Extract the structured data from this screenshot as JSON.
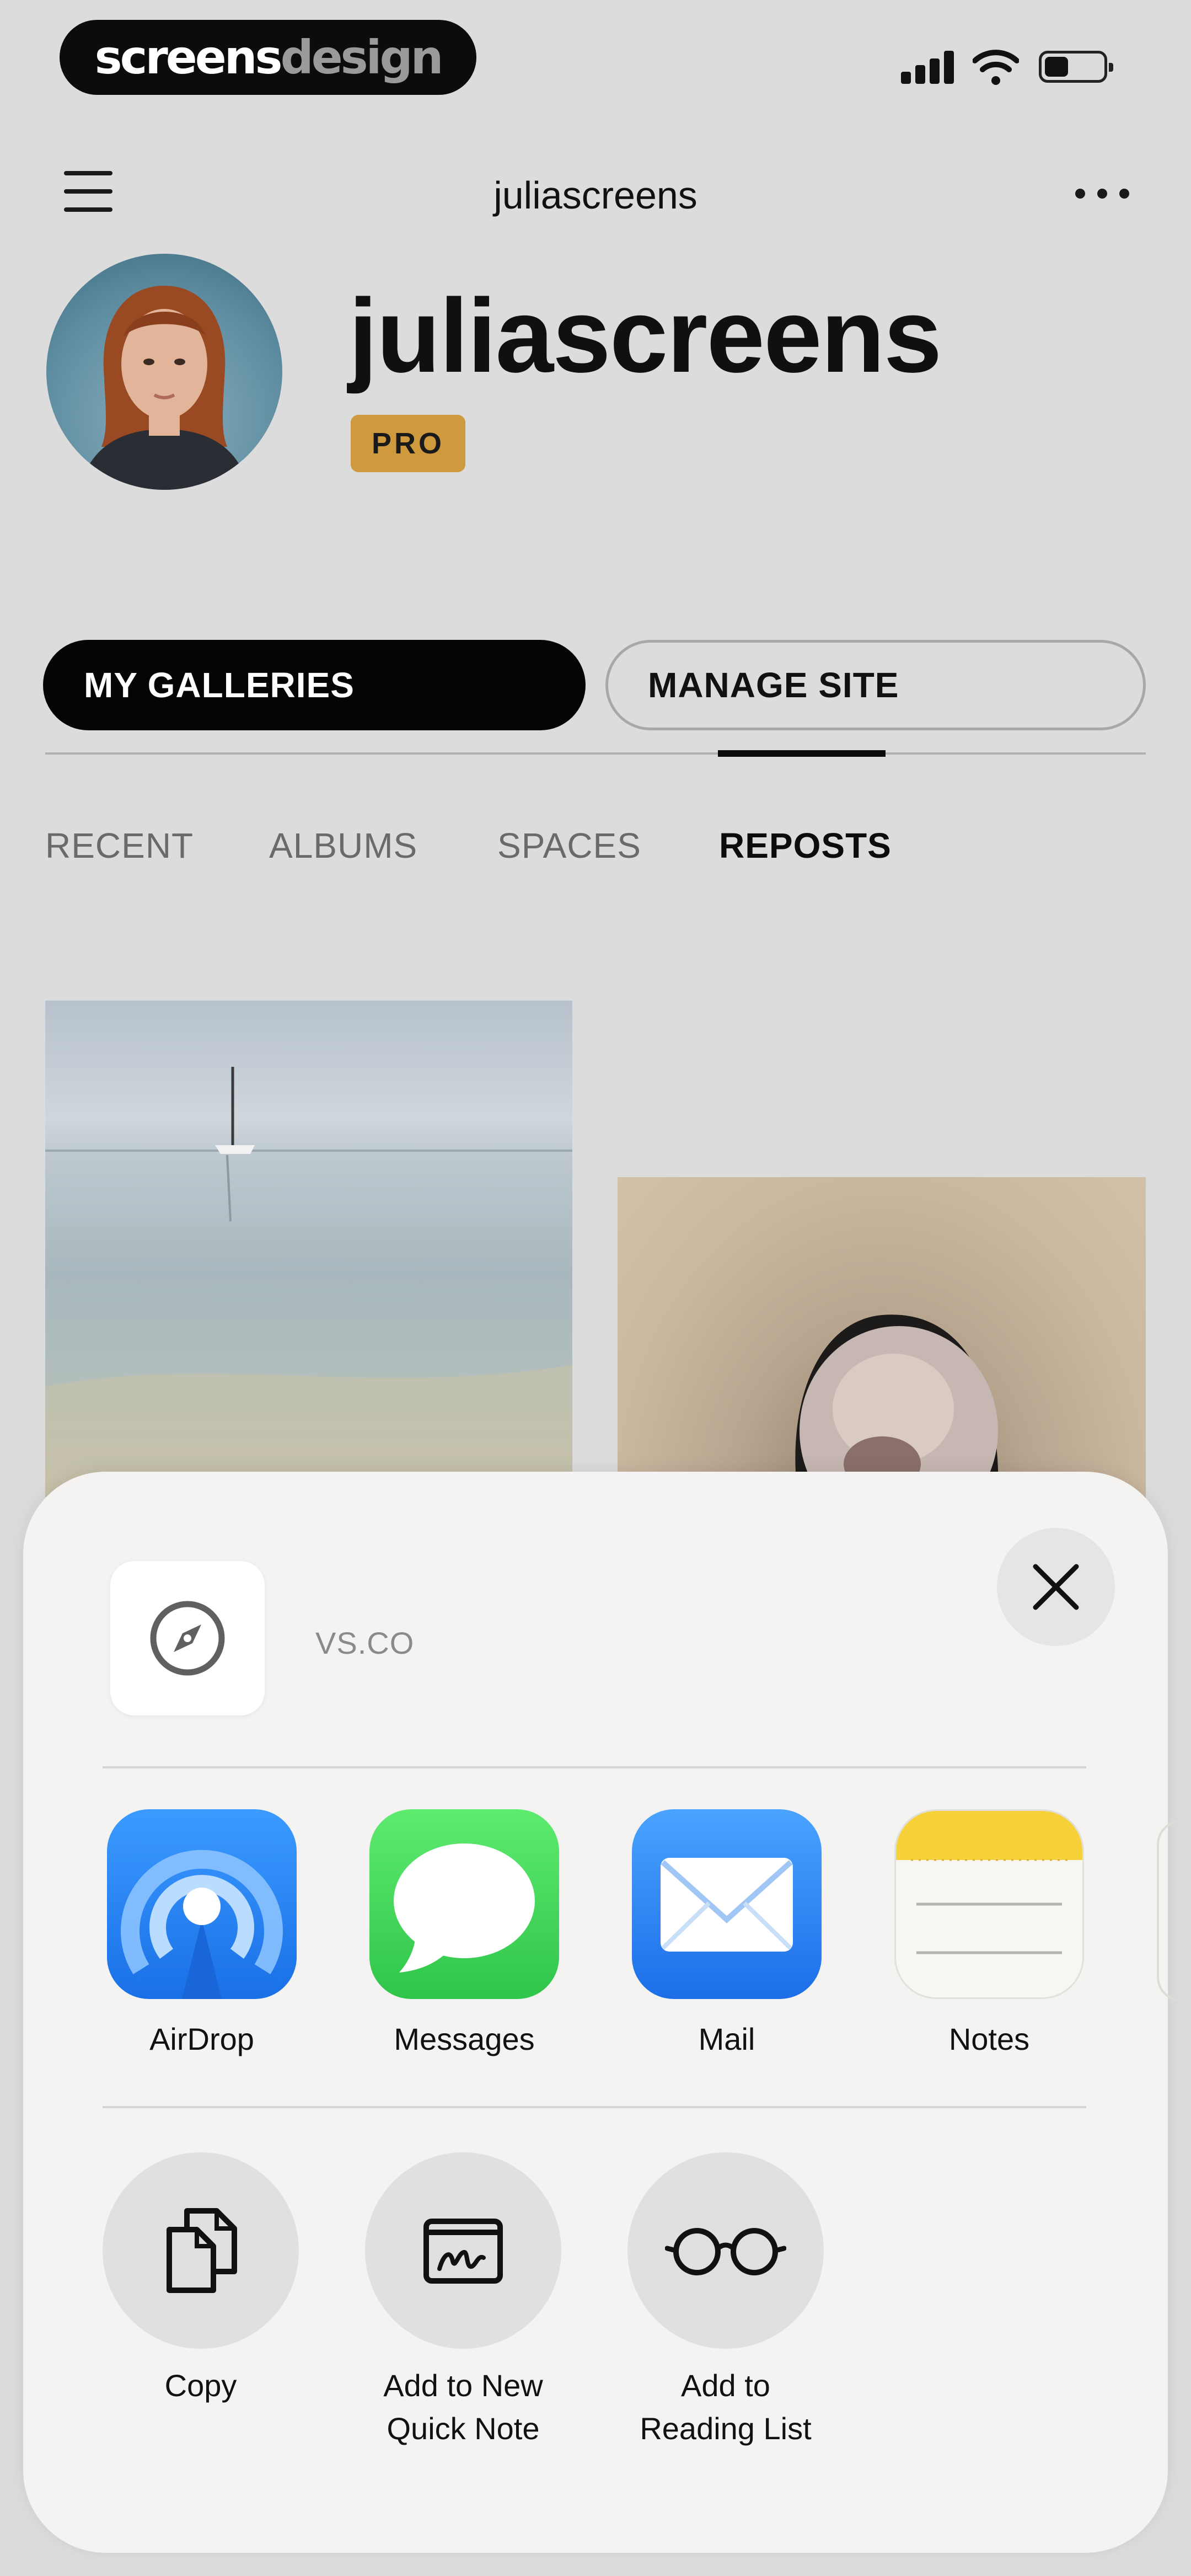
{
  "status_bar": {
    "brand_part1": "screens",
    "brand_part2": "design"
  },
  "header": {
    "title": "juliascreens",
    "menu_icon": "hamburger-icon",
    "more_icon": "ellipsis-icon"
  },
  "profile": {
    "name": "juliascreens",
    "badge": "PRO"
  },
  "buttons": {
    "my_galleries": "MY GALLERIES",
    "manage_site": "MANAGE SITE"
  },
  "tabs": [
    {
      "label": "RECENT",
      "active": false
    },
    {
      "label": "ALBUMS",
      "active": false
    },
    {
      "label": "SPACES",
      "active": false
    },
    {
      "label": "REPOSTS",
      "active": true
    }
  ],
  "share_sheet": {
    "site": "VS.CO",
    "site_icon": "compass-icon",
    "close_icon": "close-icon",
    "apps": [
      {
        "label": "AirDrop",
        "icon": "airdrop-icon"
      },
      {
        "label": "Messages",
        "icon": "messages-icon"
      },
      {
        "label": "Mail",
        "icon": "mail-icon"
      },
      {
        "label": "Notes",
        "icon": "notes-icon"
      }
    ],
    "actions": [
      {
        "label_line1": "Copy",
        "label_line2": "",
        "icon": "copy-icon"
      },
      {
        "label_line1": "Add to New",
        "label_line2": "Quick Note",
        "icon": "quick-note-icon"
      },
      {
        "label_line1": "Add to",
        "label_line2": "Reading List",
        "icon": "glasses-icon"
      }
    ]
  },
  "colors": {
    "background": "#dcdcdc",
    "pro_badge": "#cf9a3e",
    "sheet": "#f4f3f1",
    "airdrop": "#1e7bf0",
    "messages": "#34c759",
    "mail": "#2b86f5",
    "notes_yellow": "#f7d13a"
  }
}
